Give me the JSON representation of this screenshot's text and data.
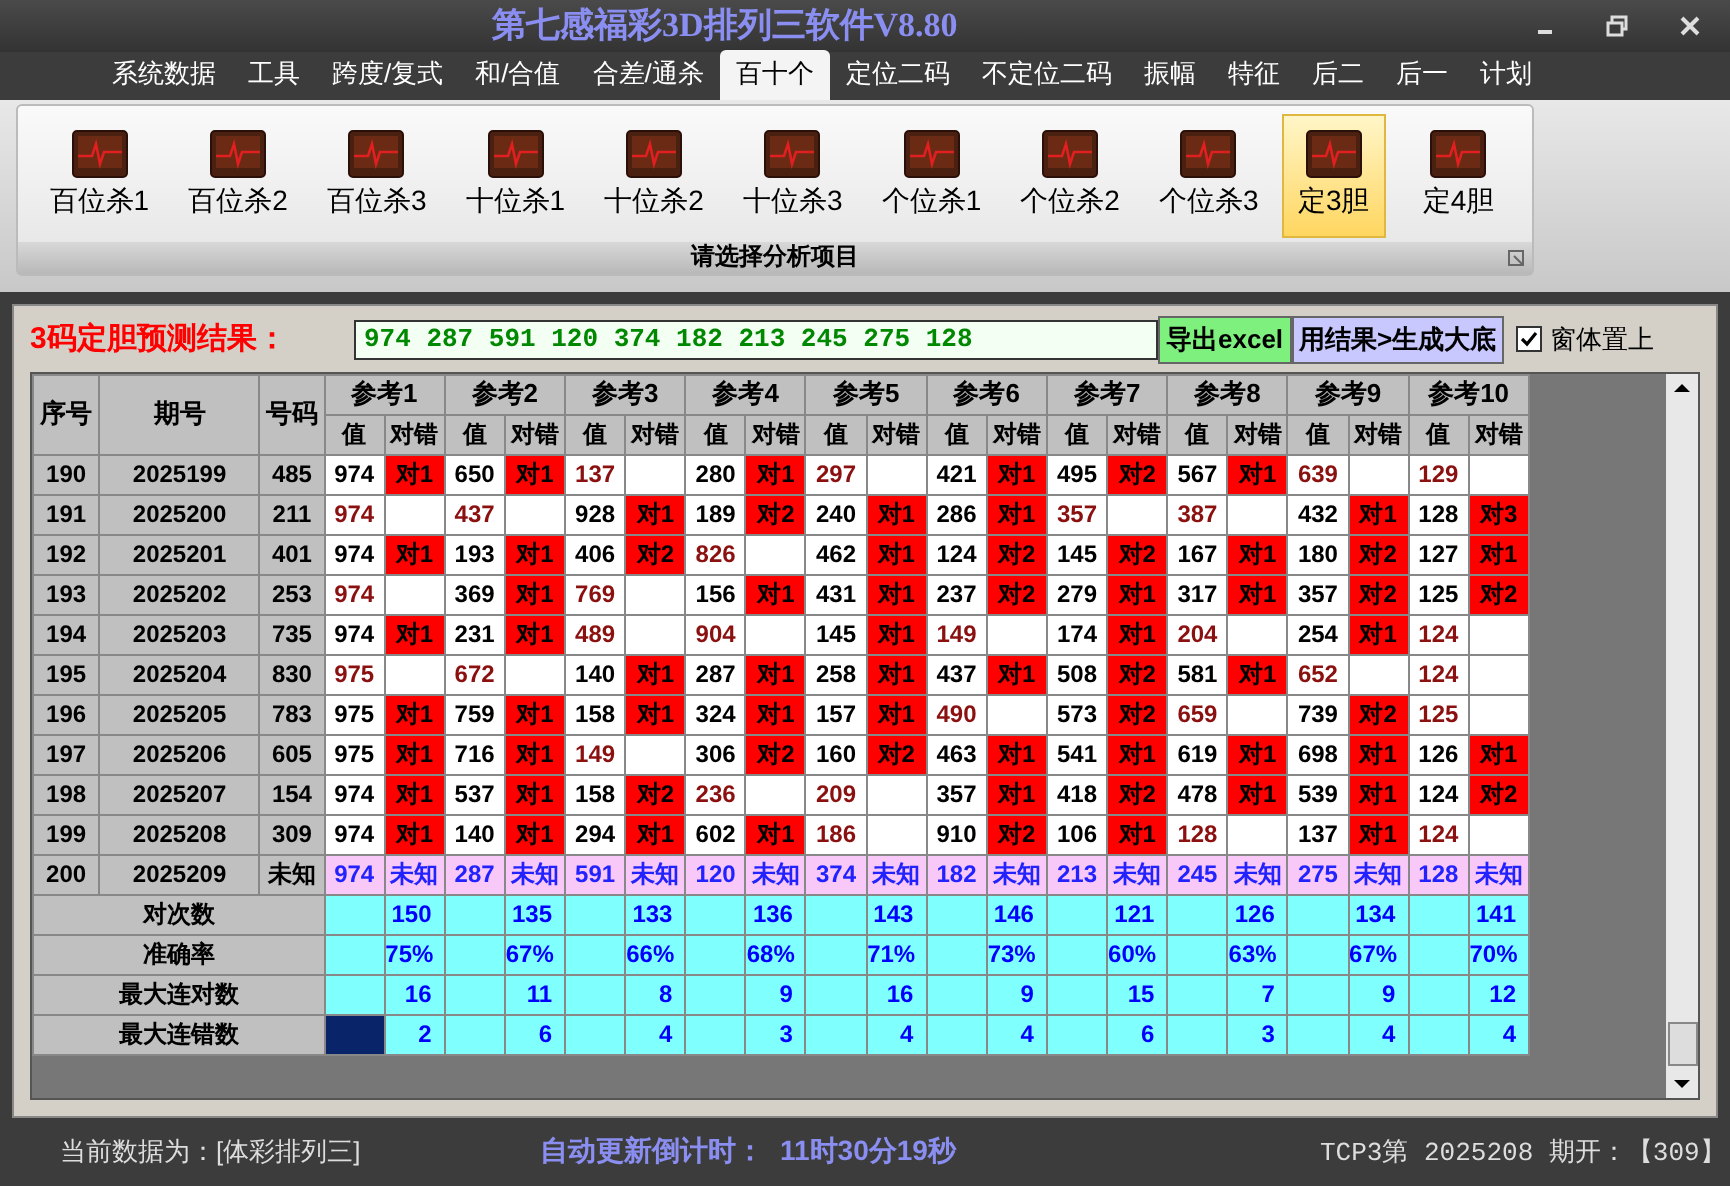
{
  "window": {
    "title": "第七感福彩3D排列三软件V8.80"
  },
  "menu": [
    {
      "label": "系统数据",
      "selected": false
    },
    {
      "label": "工具",
      "selected": false
    },
    {
      "label": "跨度/复式",
      "selected": false
    },
    {
      "label": "和/合值",
      "selected": false
    },
    {
      "label": "合差/通杀",
      "selected": false
    },
    {
      "label": "百十个",
      "selected": true
    },
    {
      "label": "定位二码",
      "selected": false
    },
    {
      "label": "不定位二码",
      "selected": false
    },
    {
      "label": "振幅",
      "selected": false
    },
    {
      "label": "特征",
      "selected": false
    },
    {
      "label": "后二",
      "selected": false
    },
    {
      "label": "后一",
      "selected": false
    },
    {
      "label": "计划",
      "selected": false
    }
  ],
  "ribbon": {
    "items": [
      {
        "label": "百位杀1",
        "selected": false
      },
      {
        "label": "百位杀2",
        "selected": false
      },
      {
        "label": "百位杀3",
        "selected": false
      },
      {
        "label": "十位杀1",
        "selected": false
      },
      {
        "label": "十位杀2",
        "selected": false
      },
      {
        "label": "十位杀3",
        "selected": false
      },
      {
        "label": "个位杀1",
        "selected": false
      },
      {
        "label": "个位杀2",
        "selected": false
      },
      {
        "label": "个位杀3",
        "selected": false
      },
      {
        "label": "定3胆",
        "selected": true
      },
      {
        "label": "定4胆",
        "selected": false
      }
    ],
    "group_label": "请选择分析项目"
  },
  "prediction": {
    "label": "3码定胆预测结果：",
    "value": "974 287 591 120 374 182 213 245 275 128",
    "export_button": "导出excel",
    "generate_button": "用结果>生成大底",
    "on_top_checkbox": {
      "label": "窗体置上",
      "checked": true
    }
  },
  "table": {
    "columns": [
      "序号",
      "期号",
      "号码"
    ],
    "groups": [
      {
        "label": "参考1",
        "sub_columns": [
          "值",
          "对错"
        ]
      },
      {
        "label": "参考2",
        "sub_columns": [
          "值",
          "对错"
        ]
      },
      {
        "label": "参考3",
        "sub_columns": [
          "值",
          "对错"
        ]
      },
      {
        "label": "参考4",
        "sub_columns": [
          "值",
          "对错"
        ]
      },
      {
        "label": "参考5",
        "sub_columns": [
          "值",
          "对错"
        ]
      },
      {
        "label": "参考6",
        "sub_columns": [
          "值",
          "对错"
        ]
      },
      {
        "label": "参考7",
        "sub_columns": [
          "值",
          "对错"
        ]
      },
      {
        "label": "参考8",
        "sub_columns": [
          "值",
          "对错"
        ]
      },
      {
        "label": "参考9",
        "sub_columns": [
          "值",
          "对错"
        ]
      },
      {
        "label": "参考10",
        "sub_columns": [
          "值",
          "对错"
        ]
      }
    ],
    "rows": [
      {
        "kind": "history",
        "no": "190",
        "issue": "2025199",
        "code": "485",
        "refs": [
          {
            "value": "974",
            "result": "对1"
          },
          {
            "value": "650",
            "result": "对1"
          },
          {
            "value": "137"
          },
          {
            "value": "280",
            "result": "对1"
          },
          {
            "value": "297"
          },
          {
            "value": "421",
            "result": "对1"
          },
          {
            "value": "495",
            "result": "对2"
          },
          {
            "value": "567",
            "result": "对1"
          },
          {
            "value": "639"
          },
          {
            "value": "129"
          }
        ]
      },
      {
        "kind": "history",
        "no": "191",
        "issue": "2025200",
        "code": "211",
        "refs": [
          {
            "value": "974"
          },
          {
            "value": "437"
          },
          {
            "value": "928",
            "result": "对1"
          },
          {
            "value": "189",
            "result": "对2"
          },
          {
            "value": "240",
            "result": "对1"
          },
          {
            "value": "286",
            "result": "对1"
          },
          {
            "value": "357"
          },
          {
            "value": "387"
          },
          {
            "value": "432",
            "result": "对1"
          },
          {
            "value": "128",
            "result": "对3"
          }
        ]
      },
      {
        "kind": "history",
        "no": "192",
        "issue": "2025201",
        "code": "401",
        "refs": [
          {
            "value": "974",
            "result": "对1"
          },
          {
            "value": "193",
            "result": "对1"
          },
          {
            "value": "406",
            "result": "对2"
          },
          {
            "value": "826"
          },
          {
            "value": "462",
            "result": "对1"
          },
          {
            "value": "124",
            "result": "对2"
          },
          {
            "value": "145",
            "result": "对2"
          },
          {
            "value": "167",
            "result": "对1"
          },
          {
            "value": "180",
            "result": "对2"
          },
          {
            "value": "127",
            "result": "对1"
          }
        ]
      },
      {
        "kind": "history",
        "no": "193",
        "issue": "2025202",
        "code": "253",
        "refs": [
          {
            "value": "974"
          },
          {
            "value": "369",
            "result": "对1"
          },
          {
            "value": "769"
          },
          {
            "value": "156",
            "result": "对1"
          },
          {
            "value": "431",
            "result": "对1"
          },
          {
            "value": "237",
            "result": "对2"
          },
          {
            "value": "279",
            "result": "对1"
          },
          {
            "value": "317",
            "result": "对1"
          },
          {
            "value": "357",
            "result": "对2"
          },
          {
            "value": "125",
            "result": "对2"
          }
        ]
      },
      {
        "kind": "history",
        "no": "194",
        "issue": "2025203",
        "code": "735",
        "refs": [
          {
            "value": "974",
            "result": "对1"
          },
          {
            "value": "231",
            "result": "对1"
          },
          {
            "value": "489"
          },
          {
            "value": "904"
          },
          {
            "value": "145",
            "result": "对1"
          },
          {
            "value": "149"
          },
          {
            "value": "174",
            "result": "对1"
          },
          {
            "value": "204"
          },
          {
            "value": "254",
            "result": "对1"
          },
          {
            "value": "124"
          }
        ]
      },
      {
        "kind": "history",
        "no": "195",
        "issue": "2025204",
        "code": "830",
        "refs": [
          {
            "value": "975"
          },
          {
            "value": "672"
          },
          {
            "value": "140",
            "result": "对1"
          },
          {
            "value": "287",
            "result": "对1"
          },
          {
            "value": "258",
            "result": "对1"
          },
          {
            "value": "437",
            "result": "对1"
          },
          {
            "value": "508",
            "result": "对2"
          },
          {
            "value": "581",
            "result": "对1"
          },
          {
            "value": "652"
          },
          {
            "value": "124"
          }
        ]
      },
      {
        "kind": "history",
        "no": "196",
        "issue": "2025205",
        "code": "783",
        "refs": [
          {
            "value": "975",
            "result": "对1"
          },
          {
            "value": "759",
            "result": "对1"
          },
          {
            "value": "158",
            "result": "对1"
          },
          {
            "value": "324",
            "result": "对1"
          },
          {
            "value": "157",
            "result": "对1"
          },
          {
            "value": "490"
          },
          {
            "value": "573",
            "result": "对2"
          },
          {
            "value": "659"
          },
          {
            "value": "739",
            "result": "对2"
          },
          {
            "value": "125"
          }
        ]
      },
      {
        "kind": "history",
        "no": "197",
        "issue": "2025206",
        "code": "605",
        "refs": [
          {
            "value": "975",
            "result": "对1"
          },
          {
            "value": "716",
            "result": "对1"
          },
          {
            "value": "149"
          },
          {
            "value": "306",
            "result": "对2"
          },
          {
            "value": "160",
            "result": "对2"
          },
          {
            "value": "463",
            "result": "对1"
          },
          {
            "value": "541",
            "result": "对1"
          },
          {
            "value": "619",
            "result": "对1"
          },
          {
            "value": "698",
            "result": "对1"
          },
          {
            "value": "126",
            "result": "对1"
          }
        ]
      },
      {
        "kind": "history",
        "no": "198",
        "issue": "2025207",
        "code": "154",
        "refs": [
          {
            "value": "974",
            "result": "对1"
          },
          {
            "value": "537",
            "result": "对1"
          },
          {
            "value": "158",
            "result": "对2"
          },
          {
            "value": "236"
          },
          {
            "value": "209"
          },
          {
            "value": "357",
            "result": "对1"
          },
          {
            "value": "418",
            "result": "对2"
          },
          {
            "value": "478",
            "result": "对1"
          },
          {
            "value": "539",
            "result": "对1"
          },
          {
            "value": "124",
            "result": "对2"
          }
        ]
      },
      {
        "kind": "history",
        "no": "199",
        "issue": "2025208",
        "code": "309",
        "refs": [
          {
            "value": "974",
            "result": "对1"
          },
          {
            "value": "140",
            "result": "对1"
          },
          {
            "value": "294",
            "result": "对1"
          },
          {
            "value": "602",
            "result": "对1"
          },
          {
            "value": "186"
          },
          {
            "value": "910",
            "result": "对2"
          },
          {
            "value": "106",
            "result": "对1"
          },
          {
            "value": "128"
          },
          {
            "value": "137",
            "result": "对1"
          },
          {
            "value": "124"
          }
        ]
      },
      {
        "kind": "forecast",
        "no": "200",
        "issue": "2025209",
        "code": "未知",
        "refs": [
          {
            "value": "974",
            "result": "未知"
          },
          {
            "value": "287",
            "result": "未知"
          },
          {
            "value": "591",
            "result": "未知"
          },
          {
            "value": "120",
            "result": "未知"
          },
          {
            "value": "374",
            "result": "未知"
          },
          {
            "value": "182",
            "result": "未知"
          },
          {
            "value": "213",
            "result": "未知"
          },
          {
            "value": "245",
            "result": "未知"
          },
          {
            "value": "275",
            "result": "未知"
          },
          {
            "value": "128",
            "result": "未知"
          }
        ]
      }
    ],
    "stats": [
      {
        "label": "对次数",
        "selected": false,
        "values": [
          "150",
          "135",
          "133",
          "136",
          "143",
          "146",
          "121",
          "126",
          "134",
          "141"
        ]
      },
      {
        "label": "准确率",
        "selected": false,
        "values": [
          "75%",
          "67%",
          "66%",
          "68%",
          "71%",
          "73%",
          "60%",
          "63%",
          "67%",
          "70%"
        ]
      },
      {
        "label": "最大连对数",
        "selected": false,
        "values": [
          "16",
          "11",
          "8",
          "9",
          "16",
          "9",
          "15",
          "7",
          "9",
          "12"
        ]
      },
      {
        "label": "最大连错数",
        "selected": true,
        "values": [
          "2",
          "6",
          "4",
          "3",
          "4",
          "4",
          "6",
          "3",
          "4",
          "4"
        ]
      }
    ]
  },
  "status_bar": {
    "data_source": "当前数据为：[体彩排列三]",
    "countdown_label": "自动更新倒计时：",
    "countdown_value": "11时30分19秒",
    "last_draw": "TCP3第 2025208 期开：【309】"
  }
}
